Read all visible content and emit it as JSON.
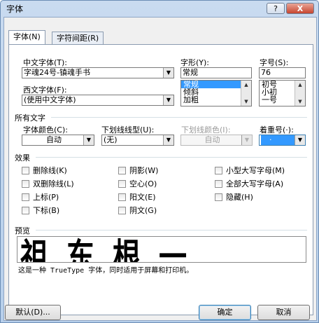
{
  "window": {
    "title": "字体",
    "help_label": "?",
    "close_label": "X"
  },
  "tabs": [
    {
      "label": "字体(N)"
    },
    {
      "label": "字符间距(R)"
    }
  ],
  "font": {
    "chinese_font_label": "中文字体(T):",
    "chinese_font_value": "字魂24号-镇魂手书",
    "western_font_label": "西文字体(F):",
    "western_font_value": "(使用中文字体)",
    "style_label": "字形(Y):",
    "style_value": "常规",
    "style_options": [
      "常规",
      "倾斜",
      "加粗"
    ],
    "size_label": "字号(S):",
    "size_value": "76",
    "size_options": [
      "初号",
      "小初",
      "一号"
    ]
  },
  "all_text": {
    "section_label": "所有文字",
    "font_color_label": "字体颜色(C):",
    "font_color_value": "自动",
    "underline_style_label": "下划线线型(U):",
    "underline_style_value": "(无)",
    "underline_color_label": "下划线颜色(I):",
    "underline_color_value": "自动",
    "emphasis_label": "着重号(·):",
    "emphasis_value": "·"
  },
  "effects": {
    "section_label": "效果",
    "items": [
      {
        "label": "删除线(K)"
      },
      {
        "label": "双删除线(L)"
      },
      {
        "label": "上标(P)"
      },
      {
        "label": "下标(B)"
      },
      {
        "label": "阴影(W)"
      },
      {
        "label": "空心(O)"
      },
      {
        "label": "阳文(E)"
      },
      {
        "label": "阴文(G)"
      },
      {
        "label": "小型大写字母(M)"
      },
      {
        "label": "全部大写字母(A)"
      },
      {
        "label": "隐藏(H)"
      }
    ]
  },
  "preview": {
    "section_label": "预览",
    "sample_text": "祖东根一",
    "description": "这是一种 TrueType 字体，同时适用于屏幕和打印机。"
  },
  "buttons": {
    "default": "默认(D)...",
    "ok": "确定",
    "cancel": "取消"
  }
}
